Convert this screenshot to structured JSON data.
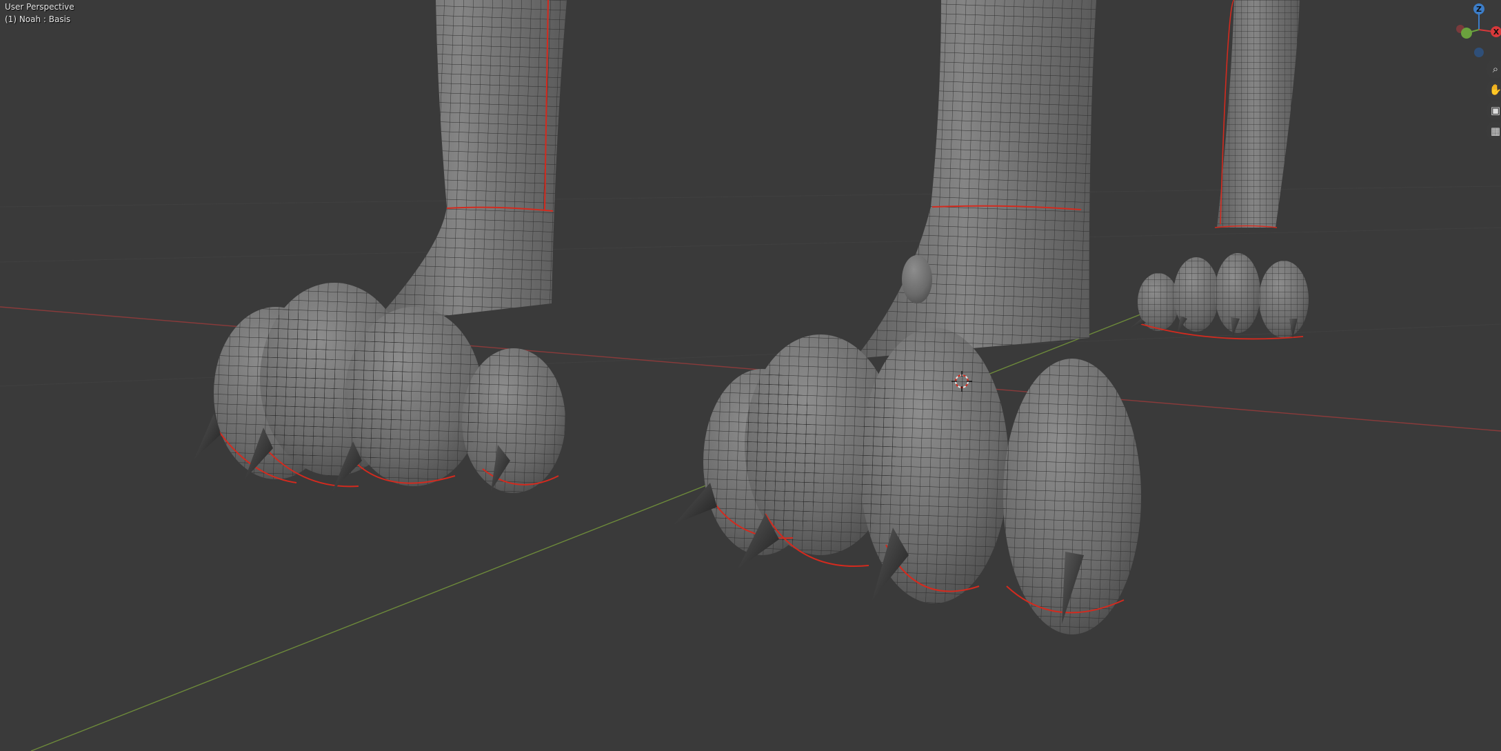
{
  "viewport": {
    "view_name": "User Perspective",
    "object_info": "(1) Noah : Basis"
  },
  "gizmo": {
    "axis_z": "Z",
    "axis_x": "X"
  },
  "nav_icons": [
    "zoom-icon",
    "hand-icon",
    "camera-icon",
    "grid-icon"
  ],
  "colors": {
    "background": "#3a3a3a",
    "x_axis": "#8a3a3a",
    "y_axis": "#6d8a3a",
    "mesh": "#707070",
    "seam": "#d42a1e",
    "gizmo_x": "#d9383a",
    "gizmo_y": "#6ba23e",
    "gizmo_z": "#3c7dc8"
  }
}
